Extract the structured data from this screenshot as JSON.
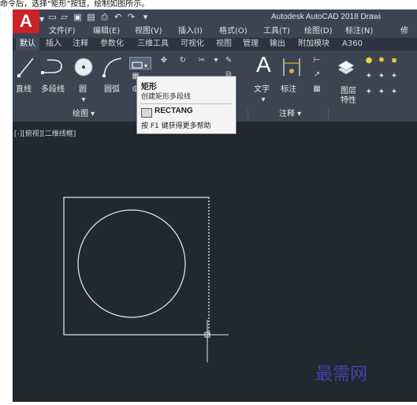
{
  "caption": "命令后，选择\"矩形\"按钮，绘制如图所示。",
  "app": {
    "logo_letter": "A",
    "title": "Autodesk AutoCAD 2018   Drawi",
    "accent_color": "#c8242a",
    "quick_access": [
      "new-icon",
      "open-icon",
      "save-icon",
      "saveas-icon",
      "print-icon",
      "undo-icon",
      "redo-icon",
      "customize-icon"
    ]
  },
  "menu": [
    "文件(F)",
    "编辑(E)",
    "视图(V)",
    "插入(I)",
    "格式(O)",
    "工具(T)",
    "绘图(D)",
    "标注(N)",
    "修"
  ],
  "tabs": [
    "默认",
    "插入",
    "注释",
    "参数化",
    "三维工具",
    "可视化",
    "视图",
    "管理",
    "输出",
    "附加模块",
    "A360"
  ],
  "active_tab": "默认",
  "ribbon": {
    "tools": {
      "line": "直线",
      "polyline": "多段线",
      "circle": "圆",
      "arc": "圆弧",
      "text": "文字",
      "dimension": "标注",
      "layer_props": "图层\n特性"
    },
    "layer_label_1": "图层",
    "layer_label_2": "特性",
    "panels": {
      "draw": "绘图 ▾",
      "annotation": "注释 ▾"
    }
  },
  "tooltip": {
    "title": "矩形",
    "description": "创建矩形多段线",
    "command": "RECTANG",
    "help": "按 F1 键获得更多帮助"
  },
  "viewport_label": "[-][俯视][二维线框]",
  "watermark": "最需网"
}
